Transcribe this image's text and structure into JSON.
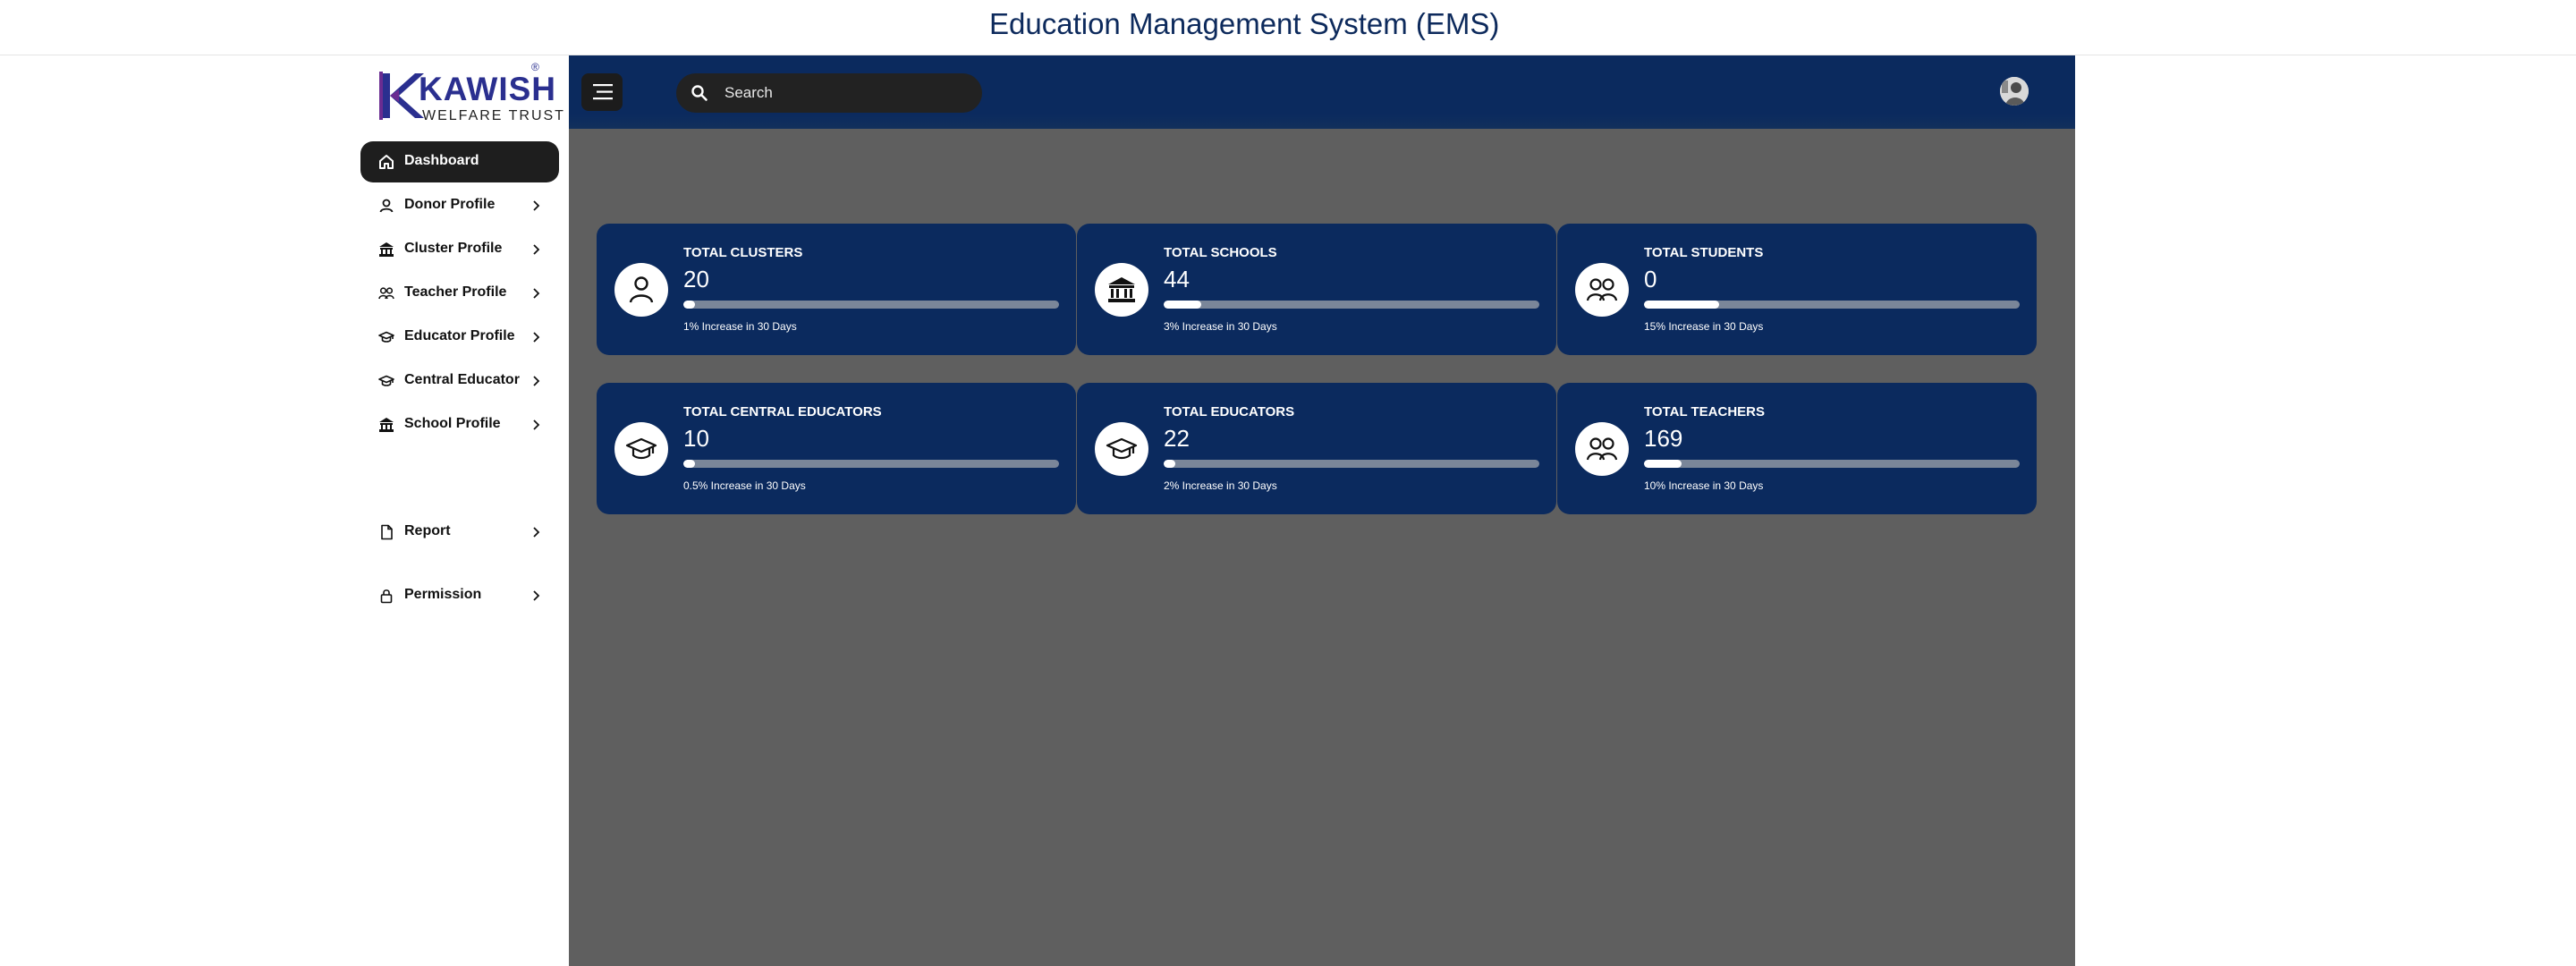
{
  "app": {
    "title": "Education Management System (EMS)"
  },
  "logo": {
    "name": "KAWISH",
    "subtitle": "WELFARE TRUST",
    "registered": "®"
  },
  "sidebar": {
    "items": [
      {
        "label": "Dashboard",
        "icon": "home-icon",
        "active": true,
        "has_chevron": false
      },
      {
        "label": "Donor Profile",
        "icon": "person-icon",
        "has_chevron": true
      },
      {
        "label": "Cluster Profile",
        "icon": "bank-icon",
        "has_chevron": true
      },
      {
        "label": "Teacher Profile",
        "icon": "group-icon",
        "has_chevron": true
      },
      {
        "label": "Educator Profile",
        "icon": "graduation-cap-icon",
        "has_chevron": true
      },
      {
        "label": "Central Educator",
        "icon": "graduation-cap-icon",
        "has_chevron": true
      },
      {
        "label": "School Profile",
        "icon": "bank-icon",
        "has_chevron": true
      },
      {
        "label": "Report",
        "icon": "document-icon",
        "has_chevron": true
      },
      {
        "label": "Permission",
        "icon": "lock-icon",
        "has_chevron": true
      }
    ]
  },
  "topbar": {
    "search_placeholder": "Search",
    "menu_icon": "hamburger-icon",
    "search_icon": "search-icon"
  },
  "colors": {
    "primary_navy": "#0b2a5e",
    "content_bg": "#5f5f5f",
    "active_nav_bg": "#1e1e1e",
    "title_color": "#0d2a5c"
  },
  "cards": [
    {
      "title": "TOTAL CLUSTERS",
      "value": "20",
      "note": "1% Increase in 30 Days",
      "progress": 0.03,
      "icon": "person-icon"
    },
    {
      "title": "TOTAL SCHOOLS",
      "value": "44",
      "note": "3% Increase in 30 Days",
      "progress": 0.1,
      "icon": "bank-icon"
    },
    {
      "title": "TOTAL STUDENTS",
      "value": "0",
      "note": "15% Increase in 30 Days",
      "progress": 0.2,
      "icon": "group-icon"
    },
    {
      "title": "TOTAL CENTRAL EDUCATORS",
      "value": "10",
      "note": "0.5% Increase in 30 Days",
      "progress": 0.03,
      "icon": "graduation-cap-icon"
    },
    {
      "title": "TOTAL EDUCATORS",
      "value": "22",
      "note": "2% Increase in 30 Days",
      "progress": 0.03,
      "icon": "graduation-cap-icon"
    },
    {
      "title": "TOTAL TEACHERS",
      "value": "169",
      "note": "10% Increase in 30 Days",
      "progress": 0.1,
      "icon": "group-icon"
    }
  ]
}
